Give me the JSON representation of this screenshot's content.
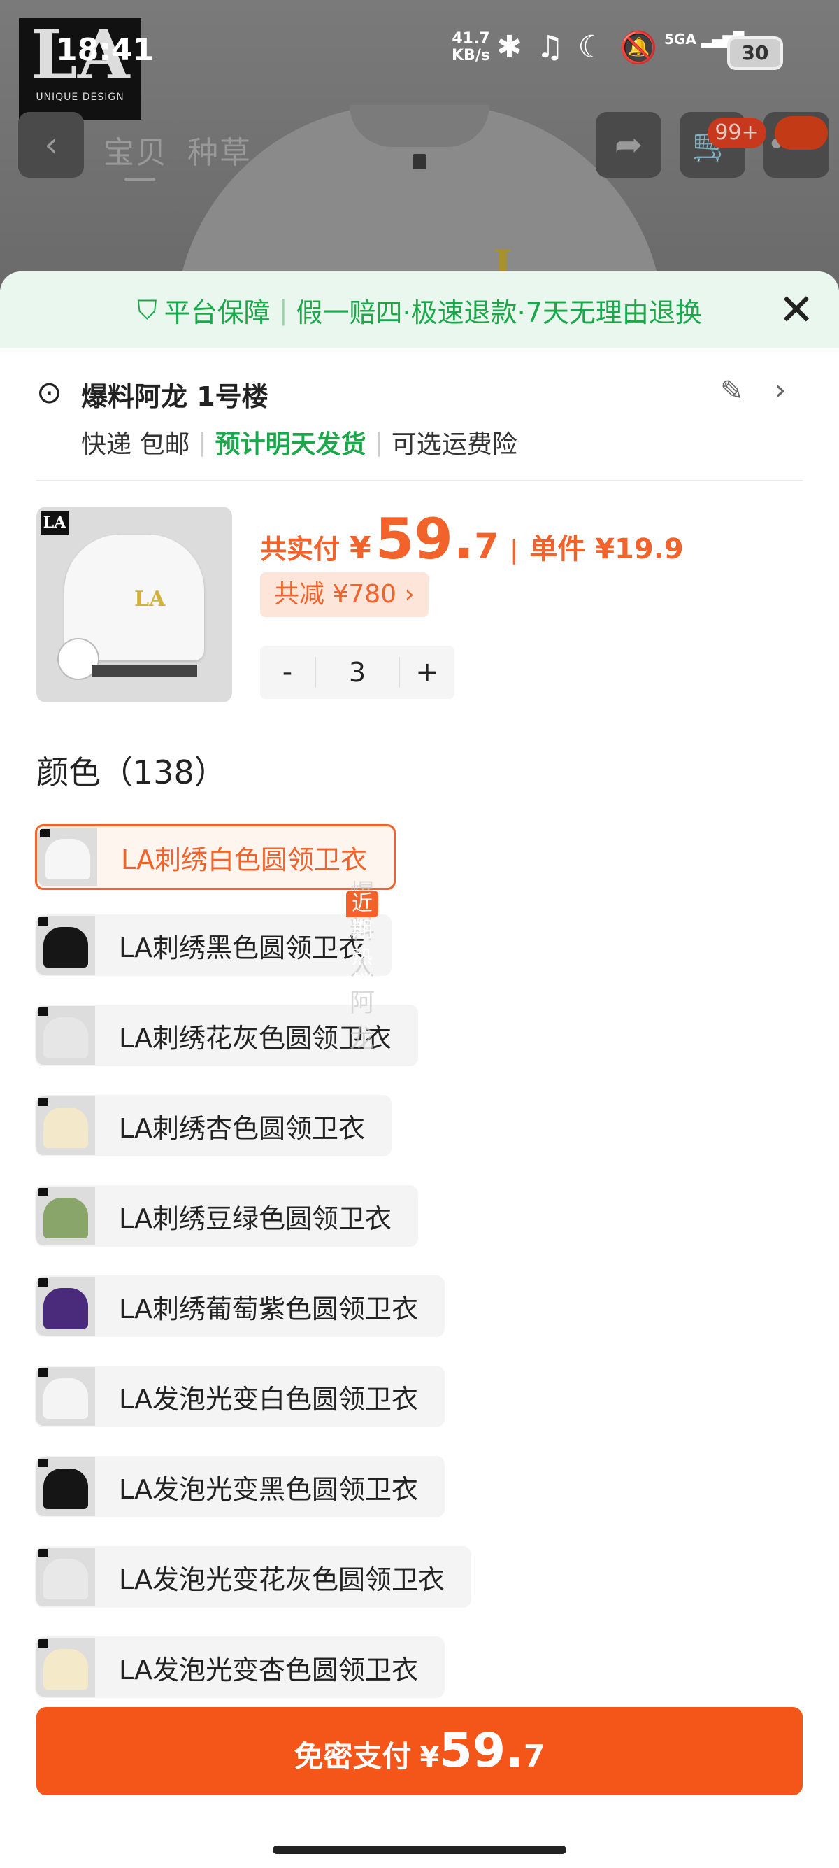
{
  "status_bar": {
    "time": "18:41",
    "net_speed_value": "41.7",
    "net_speed_unit": "KB/s",
    "signal_label": "5GA",
    "battery": "30"
  },
  "brand_logo": {
    "letters": "LA",
    "subtitle": "UNIQUE DESIGN"
  },
  "nav": {
    "tabs": [
      "宝贝",
      "种草"
    ],
    "cart_badge": "99+"
  },
  "guarantee": {
    "title": "平台保障",
    "items": "假一赔四·极速退款·7天无理由退换"
  },
  "address": {
    "name": "爆料阿龙 1号楼",
    "delivery_parts": [
      "快递 包邮",
      "预计明天发货",
      "可选运费险"
    ]
  },
  "price": {
    "total_label": "共实付",
    "currency": "¥",
    "total_int": "59.",
    "total_dec": "7",
    "unit_label": "单件 ¥19.9",
    "reduce_label": "共减 ¥780 ›"
  },
  "quantity": {
    "minus": "-",
    "value": "3",
    "plus": "+"
  },
  "color_section": {
    "title": "颜色（138）"
  },
  "colors": [
    {
      "label": "LA刺绣白色圆领卫衣",
      "selected": true,
      "shirt": "#f6f6f6"
    },
    {
      "label": "LA刺绣黑色圆领卫衣",
      "selected": false,
      "shirt": "#161616"
    },
    {
      "label": "LA刺绣花灰色圆领卫衣",
      "selected": false,
      "shirt": "#e6e6e6"
    },
    {
      "label": "LA刺绣杏色圆领卫衣",
      "selected": false,
      "shirt": "#f3e8c9"
    },
    {
      "label": "LA刺绣豆绿色圆领卫衣",
      "selected": false,
      "shirt": "#8aa56a"
    },
    {
      "label": "LA刺绣葡萄紫色圆领卫衣",
      "selected": false,
      "shirt": "#4a2a7a"
    },
    {
      "label": "LA发泡光变白色圆领卫衣",
      "selected": false,
      "shirt": "#f4f4f4"
    },
    {
      "label": "LA发泡光变黑色圆领卫衣",
      "selected": false,
      "shirt": "#151515"
    },
    {
      "label": "LA发泡光变花灰色圆领卫衣",
      "selected": false,
      "shirt": "#e8e8e8"
    },
    {
      "label": "LA发泡光变杏色圆领卫衣",
      "selected": false,
      "shirt": "#f4e9c8"
    }
  ],
  "hot_tag": "近期热销",
  "watermark": "爆料人阿龙",
  "pay_button": {
    "label": "免密支付",
    "currency": "¥",
    "int": "59.",
    "dec": "7"
  },
  "colors_theme": {
    "accent": "#f2622b",
    "green": "#1aa84a"
  }
}
